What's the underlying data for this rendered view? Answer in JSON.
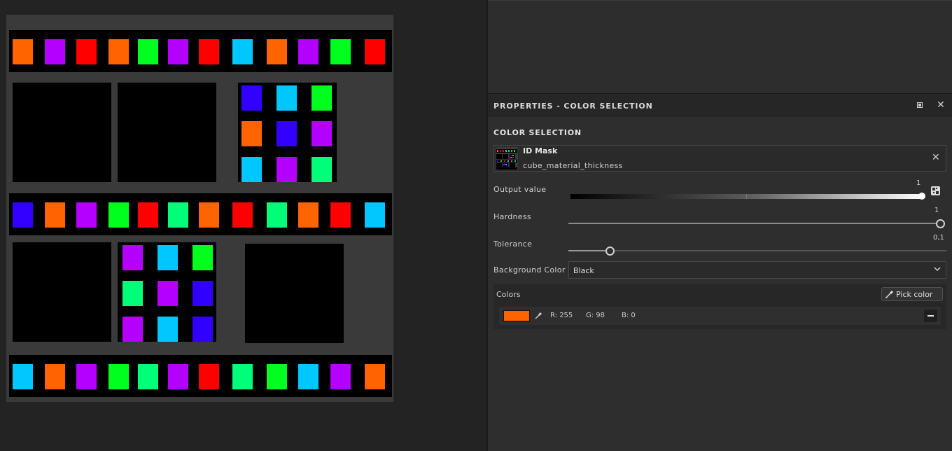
{
  "viewport": {
    "strip_colors": [
      [
        "#ff6400",
        "#b400ff",
        "#ff0000",
        "#ff6400",
        "#00ff1e",
        "#b400ff",
        "#ff0000",
        "#00c8ff",
        "#ff6400",
        "#b400ff",
        "#00ff1e",
        "#ff0000"
      ],
      [
        "#3200ff",
        "#ff6400",
        "#b400ff",
        "#00ff1e",
        "#ff0000",
        "#00ff78",
        "#ff6400",
        "#ff0000",
        "#00ff78",
        "#ff6400",
        "#ff0000",
        "#00c8ff"
      ],
      [
        "#00c8ff",
        "#ff6400",
        "#b400ff",
        "#00ff1e",
        "#00ff78",
        "#b400ff",
        "#ff0000",
        "#00ff78",
        "#00ff1e",
        "#00c8ff",
        "#b400ff",
        "#ff6400"
      ]
    ],
    "grid_a": [
      "#3200ff",
      "#00c8ff",
      "#00ff1e",
      "#ff6400",
      "#3200ff",
      "#b400ff",
      "#00c8ff",
      "#b400ff",
      "#00ff78"
    ],
    "grid_b": [
      "#b400ff",
      "#00c8ff",
      "#00ff1e",
      "#00ff78",
      "#b400ff",
      "#3200ff",
      "#b400ff",
      "#00c8ff",
      "#3200ff"
    ]
  },
  "panel": {
    "title": "PROPERTIES - COLOR SELECTION",
    "section_title": "COLOR SELECTION",
    "mask": {
      "name": "ID Mask",
      "file": "cube_material_thickness"
    },
    "output": {
      "label": "Output value",
      "value": "1"
    },
    "hardness": {
      "label": "Hardness",
      "value": "1"
    },
    "tolerance": {
      "label": "Tolerance",
      "value": "0,1"
    },
    "background": {
      "label": "Background Color",
      "value": "Black"
    },
    "colors": {
      "label": "Colors",
      "pick_label": "Pick color",
      "entry": {
        "swatch": "#ff6200",
        "r": "R: 255",
        "g": "G: 98",
        "b": "B: 0"
      }
    }
  }
}
